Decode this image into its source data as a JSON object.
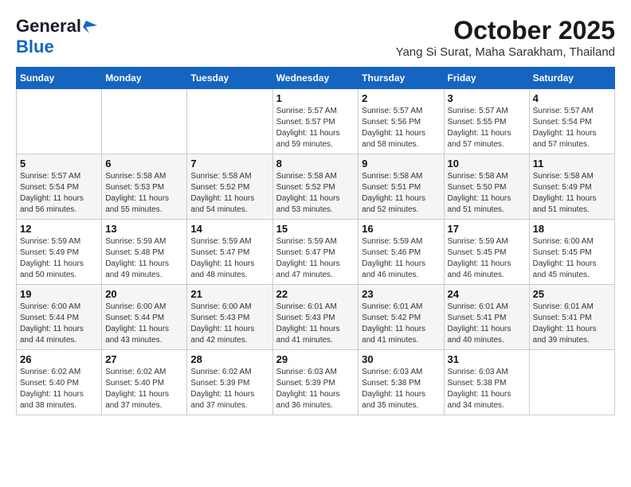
{
  "logo": {
    "line1": "General",
    "line2": "Blue"
  },
  "title": "October 2025",
  "subtitle": "Yang Si Surat, Maha Sarakham, Thailand",
  "days_of_week": [
    "Sunday",
    "Monday",
    "Tuesday",
    "Wednesday",
    "Thursday",
    "Friday",
    "Saturday"
  ],
  "weeks": [
    [
      {
        "day": "",
        "info": ""
      },
      {
        "day": "",
        "info": ""
      },
      {
        "day": "",
        "info": ""
      },
      {
        "day": "1",
        "info": "Sunrise: 5:57 AM\nSunset: 5:57 PM\nDaylight: 11 hours\nand 59 minutes."
      },
      {
        "day": "2",
        "info": "Sunrise: 5:57 AM\nSunset: 5:56 PM\nDaylight: 11 hours\nand 58 minutes."
      },
      {
        "day": "3",
        "info": "Sunrise: 5:57 AM\nSunset: 5:55 PM\nDaylight: 11 hours\nand 57 minutes."
      },
      {
        "day": "4",
        "info": "Sunrise: 5:57 AM\nSunset: 5:54 PM\nDaylight: 11 hours\nand 57 minutes."
      }
    ],
    [
      {
        "day": "5",
        "info": "Sunrise: 5:57 AM\nSunset: 5:54 PM\nDaylight: 11 hours\nand 56 minutes."
      },
      {
        "day": "6",
        "info": "Sunrise: 5:58 AM\nSunset: 5:53 PM\nDaylight: 11 hours\nand 55 minutes."
      },
      {
        "day": "7",
        "info": "Sunrise: 5:58 AM\nSunset: 5:52 PM\nDaylight: 11 hours\nand 54 minutes."
      },
      {
        "day": "8",
        "info": "Sunrise: 5:58 AM\nSunset: 5:52 PM\nDaylight: 11 hours\nand 53 minutes."
      },
      {
        "day": "9",
        "info": "Sunrise: 5:58 AM\nSunset: 5:51 PM\nDaylight: 11 hours\nand 52 minutes."
      },
      {
        "day": "10",
        "info": "Sunrise: 5:58 AM\nSunset: 5:50 PM\nDaylight: 11 hours\nand 51 minutes."
      },
      {
        "day": "11",
        "info": "Sunrise: 5:58 AM\nSunset: 5:49 PM\nDaylight: 11 hours\nand 51 minutes."
      }
    ],
    [
      {
        "day": "12",
        "info": "Sunrise: 5:59 AM\nSunset: 5:49 PM\nDaylight: 11 hours\nand 50 minutes."
      },
      {
        "day": "13",
        "info": "Sunrise: 5:59 AM\nSunset: 5:48 PM\nDaylight: 11 hours\nand 49 minutes."
      },
      {
        "day": "14",
        "info": "Sunrise: 5:59 AM\nSunset: 5:47 PM\nDaylight: 11 hours\nand 48 minutes."
      },
      {
        "day": "15",
        "info": "Sunrise: 5:59 AM\nSunset: 5:47 PM\nDaylight: 11 hours\nand 47 minutes."
      },
      {
        "day": "16",
        "info": "Sunrise: 5:59 AM\nSunset: 5:46 PM\nDaylight: 11 hours\nand 46 minutes."
      },
      {
        "day": "17",
        "info": "Sunrise: 5:59 AM\nSunset: 5:45 PM\nDaylight: 11 hours\nand 46 minutes."
      },
      {
        "day": "18",
        "info": "Sunrise: 6:00 AM\nSunset: 5:45 PM\nDaylight: 11 hours\nand 45 minutes."
      }
    ],
    [
      {
        "day": "19",
        "info": "Sunrise: 6:00 AM\nSunset: 5:44 PM\nDaylight: 11 hours\nand 44 minutes."
      },
      {
        "day": "20",
        "info": "Sunrise: 6:00 AM\nSunset: 5:44 PM\nDaylight: 11 hours\nand 43 minutes."
      },
      {
        "day": "21",
        "info": "Sunrise: 6:00 AM\nSunset: 5:43 PM\nDaylight: 11 hours\nand 42 minutes."
      },
      {
        "day": "22",
        "info": "Sunrise: 6:01 AM\nSunset: 5:43 PM\nDaylight: 11 hours\nand 41 minutes."
      },
      {
        "day": "23",
        "info": "Sunrise: 6:01 AM\nSunset: 5:42 PM\nDaylight: 11 hours\nand 41 minutes."
      },
      {
        "day": "24",
        "info": "Sunrise: 6:01 AM\nSunset: 5:41 PM\nDaylight: 11 hours\nand 40 minutes."
      },
      {
        "day": "25",
        "info": "Sunrise: 6:01 AM\nSunset: 5:41 PM\nDaylight: 11 hours\nand 39 minutes."
      }
    ],
    [
      {
        "day": "26",
        "info": "Sunrise: 6:02 AM\nSunset: 5:40 PM\nDaylight: 11 hours\nand 38 minutes."
      },
      {
        "day": "27",
        "info": "Sunrise: 6:02 AM\nSunset: 5:40 PM\nDaylight: 11 hours\nand 37 minutes."
      },
      {
        "day": "28",
        "info": "Sunrise: 6:02 AM\nSunset: 5:39 PM\nDaylight: 11 hours\nand 37 minutes."
      },
      {
        "day": "29",
        "info": "Sunrise: 6:03 AM\nSunset: 5:39 PM\nDaylight: 11 hours\nand 36 minutes."
      },
      {
        "day": "30",
        "info": "Sunrise: 6:03 AM\nSunset: 5:38 PM\nDaylight: 11 hours\nand 35 minutes."
      },
      {
        "day": "31",
        "info": "Sunrise: 6:03 AM\nSunset: 5:38 PM\nDaylight: 11 hours\nand 34 minutes."
      },
      {
        "day": "",
        "info": ""
      }
    ]
  ]
}
